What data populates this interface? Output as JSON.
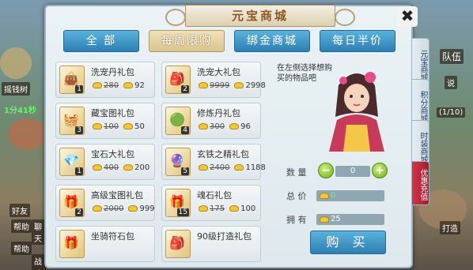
{
  "shop": {
    "title": "元宝商城",
    "close_label": "✖"
  },
  "tabs": [
    {
      "label": "全 部",
      "active": false
    },
    {
      "label": "每周限购",
      "active": true
    },
    {
      "label": "绑金商城",
      "active": false
    },
    {
      "label": "每日半价",
      "active": false
    }
  ],
  "side_tabs": [
    {
      "label": "元宝商城"
    },
    {
      "label": "积分商城"
    },
    {
      "label": "时装商城"
    },
    {
      "label": "优惠充值"
    }
  ],
  "items": [
    {
      "name": "洗宠丹礼包",
      "qty": "1",
      "old_price": "280",
      "price": "92",
      "icon": "bag-icon",
      "glyph": "👜"
    },
    {
      "name": "洗宠大礼包",
      "qty": "2",
      "old_price": "9999",
      "price": "2998",
      "icon": "pouch-icon",
      "glyph": "🎒"
    },
    {
      "name": "藏宝图礼包",
      "qty": "3",
      "old_price": "100",
      "price": "50",
      "icon": "treasure-icon",
      "glyph": "🧺"
    },
    {
      "name": "修炼丹礼包",
      "qty": "4",
      "old_price": "300",
      "price": "96",
      "icon": "pill-bag-icon",
      "glyph": "🟢"
    },
    {
      "name": "宝石大礼包",
      "qty": "1",
      "old_price": "400",
      "price": "200",
      "icon": "gem-bag-icon",
      "glyph": "💎"
    },
    {
      "name": "玄铁之精礼包",
      "qty": "5",
      "old_price": "2400",
      "price": "1188",
      "icon": "iron-bag-icon",
      "glyph": "🔮"
    },
    {
      "name": "高级宝图礼包",
      "qty": "2",
      "old_price": "2000",
      "price": "999",
      "icon": "map-bag-icon",
      "glyph": "🎁"
    },
    {
      "name": "魂石礼包",
      "qty": "15",
      "old_price": "175",
      "price": "100",
      "icon": "gift-box-icon",
      "glyph": "🎁"
    },
    {
      "name": "坐骑符石包",
      "qty": "",
      "old_price": "",
      "price": "",
      "icon": "gift-icon",
      "glyph": "🎁"
    },
    {
      "name": "90级打造礼包",
      "qty": "",
      "old_price": "",
      "price": "",
      "icon": "forge-icon",
      "glyph": "🎒"
    }
  ],
  "detail": {
    "hint": "在左侧选择想购买的物品吧",
    "qty_label": "数 量",
    "qty_value": "0",
    "total_label": "总 价",
    "total_value": "0",
    "own_label": "拥 有",
    "own_value": "25",
    "buy_label": "购 买"
  },
  "background": {
    "left_labels": [
      "摇钱树",
      "1分41秒",
      "好友",
      "帮助",
      "聊天",
      "帮助",
      "战斗"
    ],
    "right_labels": [
      "队伍",
      "说",
      "(1/10)",
      "打造"
    ]
  }
}
